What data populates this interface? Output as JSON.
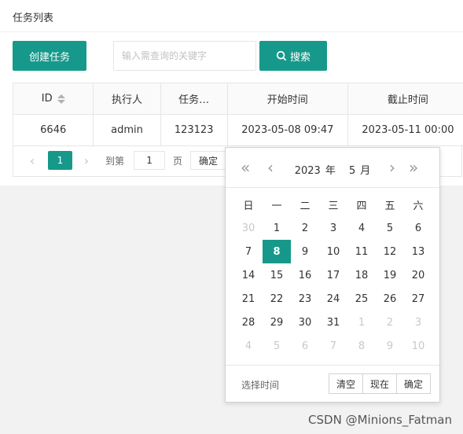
{
  "panel": {
    "title": "任务列表"
  },
  "toolbar": {
    "create_label": "创建任务",
    "search_placeholder": "输入需查询的关键字",
    "search_value": "",
    "search_label": "搜索"
  },
  "table": {
    "columns": [
      "ID",
      "执行人",
      "任务…",
      "开始时间",
      "截止时间"
    ],
    "rows": [
      [
        "6646",
        "admin",
        "123123",
        "2023-05-08 09:47",
        "2023-05-11 00:00"
      ]
    ]
  },
  "pager": {
    "current_page": "1",
    "goto_label": "到第",
    "goto_value": "1",
    "page_unit": "页",
    "ok_label": "确定"
  },
  "calendar": {
    "year": "2023",
    "year_unit": "年",
    "month": "5",
    "month_unit": "月",
    "weekdays": [
      "日",
      "一",
      "二",
      "三",
      "四",
      "五",
      "六"
    ],
    "weeks": [
      [
        "30",
        "1",
        "2",
        "3",
        "4",
        "5",
        "6"
      ],
      [
        "7",
        "8",
        "9",
        "10",
        "11",
        "12",
        "13"
      ],
      [
        "14",
        "15",
        "16",
        "17",
        "18",
        "19",
        "20"
      ],
      [
        "21",
        "22",
        "23",
        "24",
        "25",
        "26",
        "27"
      ],
      [
        "28",
        "29",
        "30",
        "31",
        "1",
        "2",
        "3"
      ],
      [
        "4",
        "5",
        "6",
        "7",
        "8",
        "9",
        "10"
      ]
    ],
    "selected_day": "8",
    "choose_time_label": "选择时间",
    "clear_label": "清空",
    "now_label": "现在",
    "confirm_label": "确定"
  },
  "watermark": "CSDN @Minions_Fatman",
  "colors": {
    "accent": "#16998a"
  }
}
